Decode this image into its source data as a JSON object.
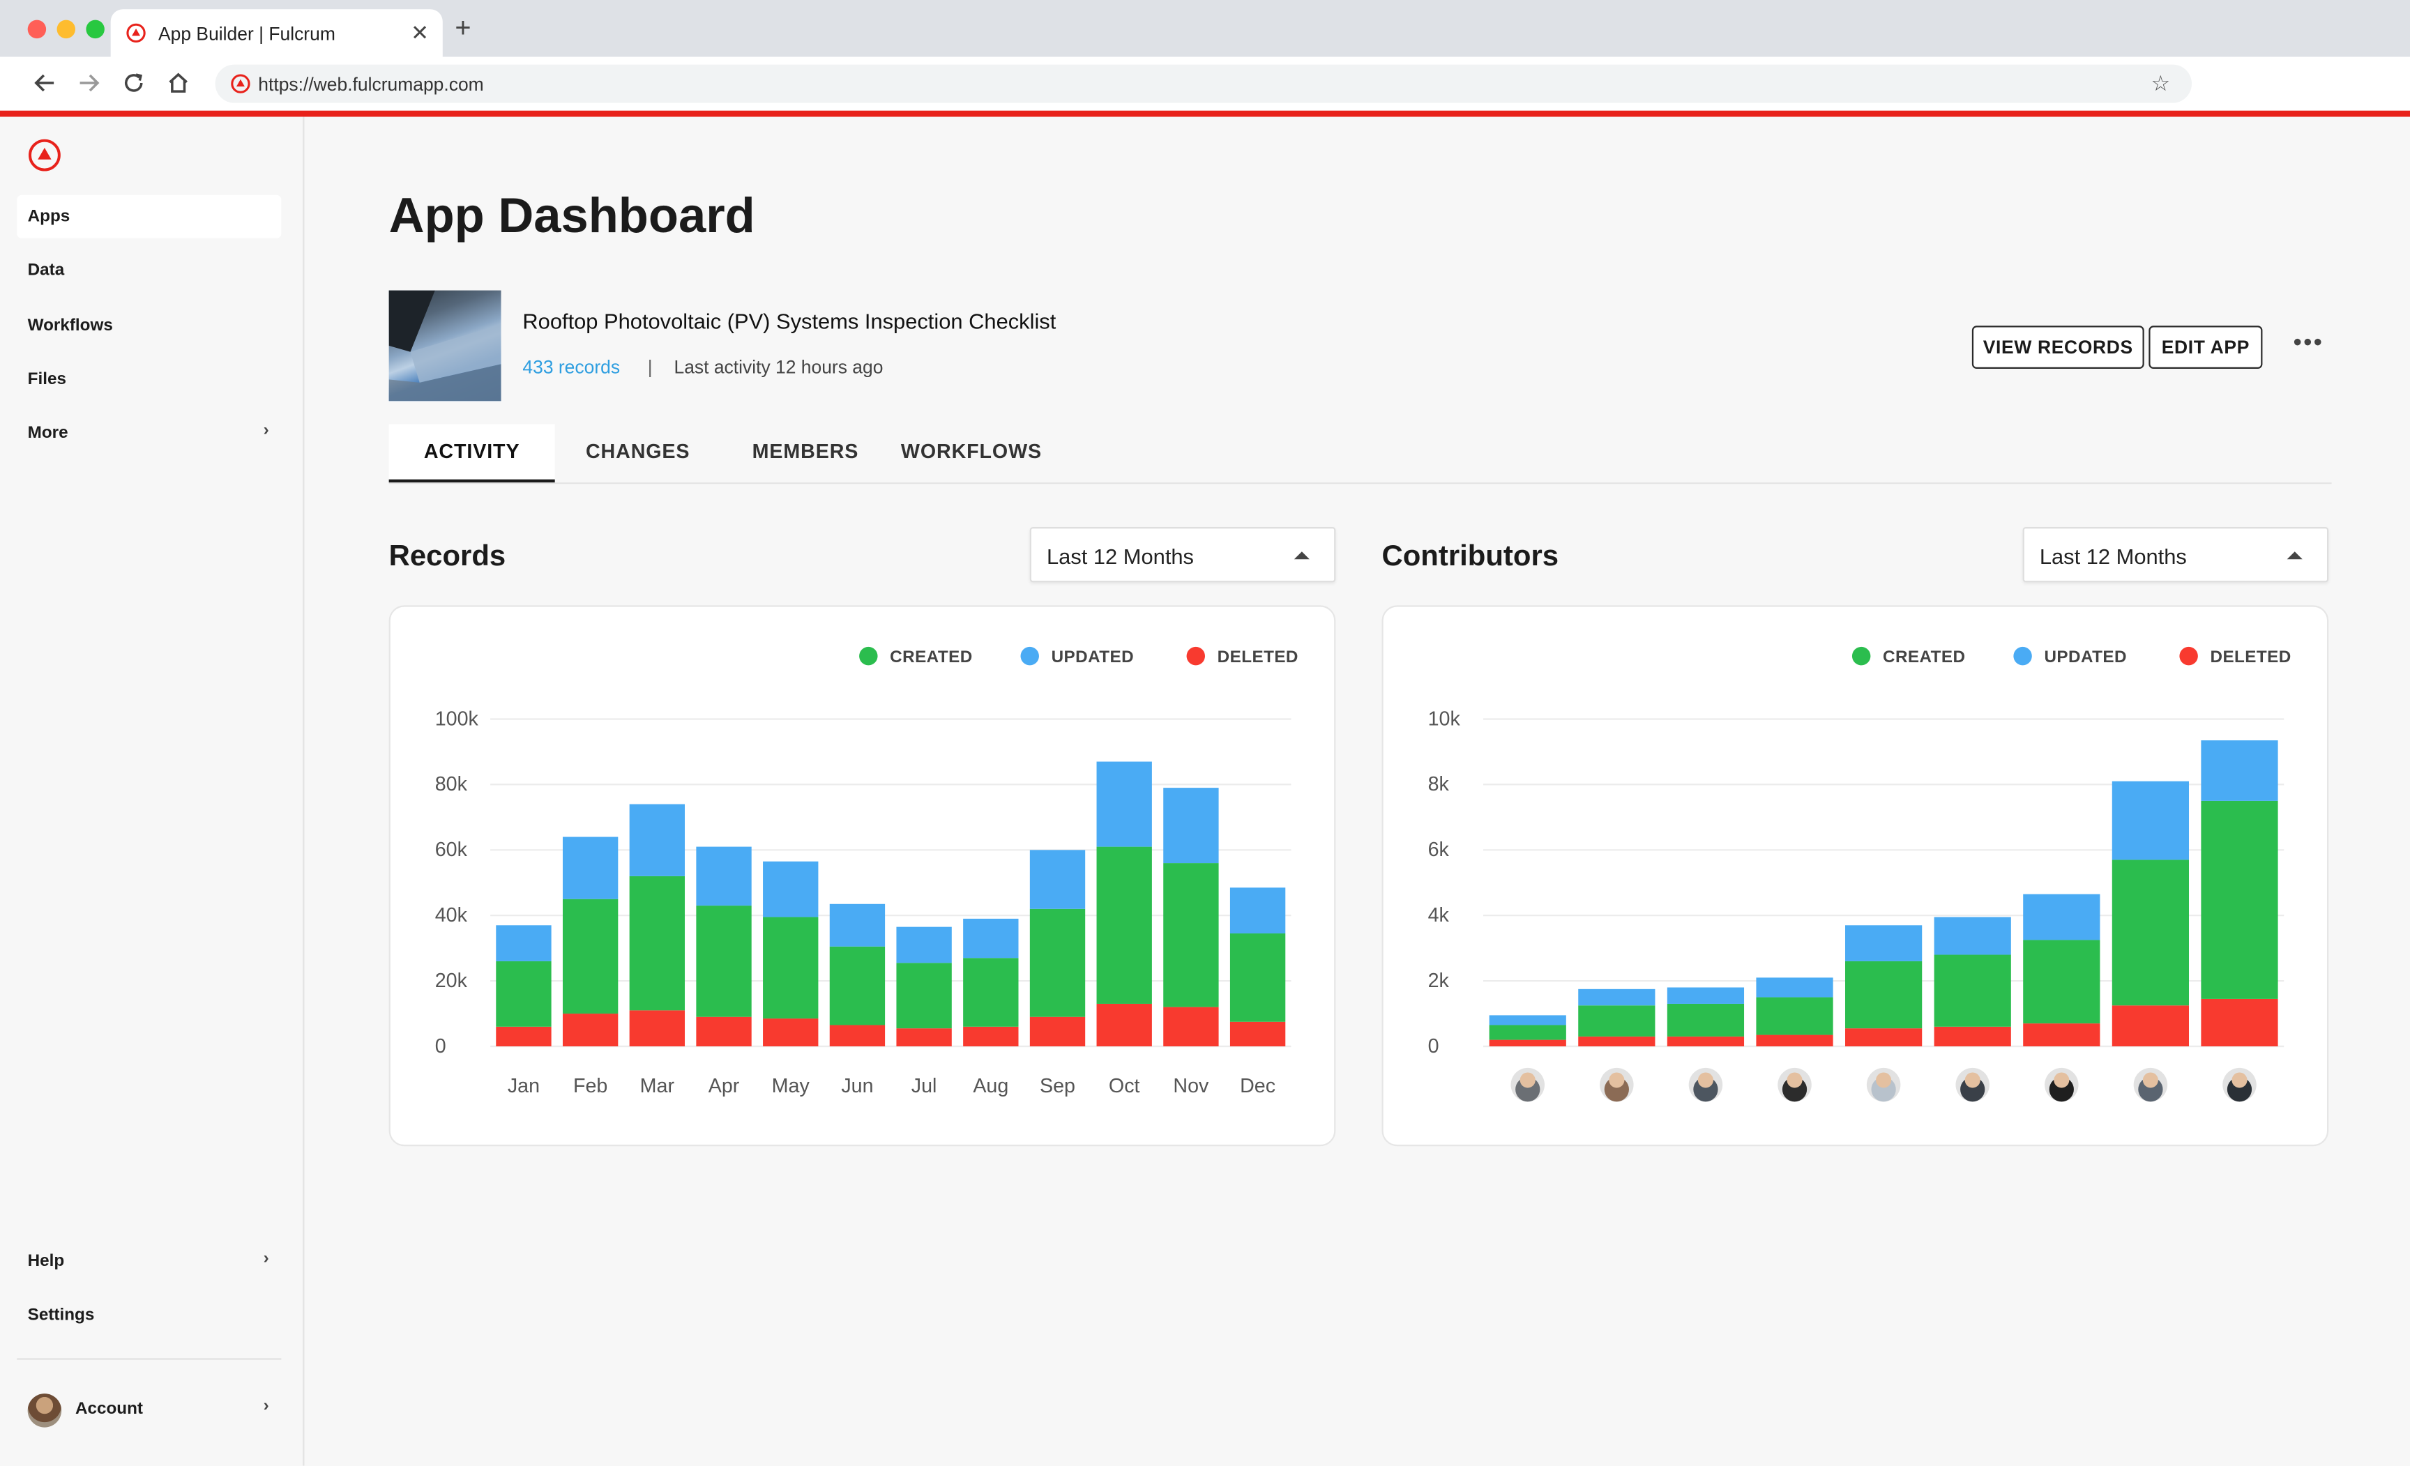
{
  "browser": {
    "tab_title": "App Builder | Fulcrum",
    "url": "https://web.fulcrumapp.com"
  },
  "sidebar": {
    "items": [
      {
        "label": "Apps",
        "active": true
      },
      {
        "label": "Data"
      },
      {
        "label": "Workflows"
      },
      {
        "label": "Files"
      },
      {
        "label": "More",
        "has_chevron": true
      }
    ],
    "bottom_items": [
      {
        "label": "Help",
        "has_chevron": true
      },
      {
        "label": "Settings"
      }
    ],
    "account_label": "Account"
  },
  "page": {
    "title": "App Dashboard",
    "app_name": "Rooftop Photovoltaic (PV) Systems Inspection Checklist",
    "records_link": "433 records",
    "separator": "|",
    "last_activity": "Last activity 12 hours ago",
    "view_records_label": "VIEW RECORDS",
    "edit_app_label": "EDIT APP",
    "more_label": "•••"
  },
  "tabs": [
    {
      "label": "ACTIVITY",
      "active": true
    },
    {
      "label": "CHANGES"
    },
    {
      "label": "MEMBERS"
    },
    {
      "label": "WORKFLOWS"
    }
  ],
  "records_panel": {
    "title": "Records",
    "range": "Last 12 Months"
  },
  "contributors_panel": {
    "title": "Contributors",
    "range": "Last 12 Months"
  },
  "legend": {
    "created": "CREATED",
    "updated": "UPDATED",
    "deleted": "DELETED"
  },
  "colors": {
    "created": "#2bbd4e",
    "updated": "#4aabf4",
    "deleted": "#f83a2f",
    "accent": "#e8221b",
    "link": "#2e9ee0"
  },
  "chart_data": [
    {
      "type": "bar",
      "stacked": true,
      "title": "Records",
      "categories": [
        "Jan",
        "Feb",
        "Mar",
        "Apr",
        "May",
        "Jun",
        "Jul",
        "Aug",
        "Sep",
        "Oct",
        "Nov",
        "Dec"
      ],
      "series": [
        {
          "name": "DELETED",
          "values": [
            6000,
            10000,
            11000,
            9000,
            8500,
            6500,
            5500,
            6000,
            9000,
            13000,
            12000,
            7500
          ]
        },
        {
          "name": "CREATED",
          "values": [
            20000,
            35000,
            41000,
            34000,
            31000,
            24000,
            20000,
            21000,
            33000,
            48000,
            44000,
            27000
          ]
        },
        {
          "name": "UPDATED",
          "values": [
            11000,
            19000,
            22000,
            18000,
            17000,
            13000,
            11000,
            12000,
            18000,
            26000,
            23000,
            14000
          ]
        }
      ],
      "ylim": [
        0,
        100000
      ],
      "yticks": [
        "0",
        "20k",
        "40k",
        "60k",
        "80k",
        "100k"
      ],
      "legend_position": "top-right",
      "grid": true
    },
    {
      "type": "bar",
      "stacked": true,
      "title": "Contributors",
      "categories": [
        "contributor-1",
        "contributor-2",
        "contributor-3",
        "contributor-4",
        "contributor-5",
        "contributor-6",
        "contributor-7",
        "contributor-8",
        "contributor-9"
      ],
      "series": [
        {
          "name": "DELETED",
          "values": [
            200,
            300,
            300,
            350,
            550,
            600,
            700,
            1250,
            1450
          ]
        },
        {
          "name": "CREATED",
          "values": [
            450,
            950,
            1000,
            1150,
            2050,
            2200,
            2550,
            4450,
            6050
          ]
        },
        {
          "name": "UPDATED",
          "values": [
            300,
            500,
            500,
            600,
            1100,
            1150,
            1400,
            2400,
            1850
          ]
        }
      ],
      "ylim": [
        0,
        10000
      ],
      "yticks": [
        "0",
        "2k",
        "4k",
        "6k",
        "8k",
        "10k"
      ],
      "legend_position": "top-right",
      "grid": true
    }
  ]
}
